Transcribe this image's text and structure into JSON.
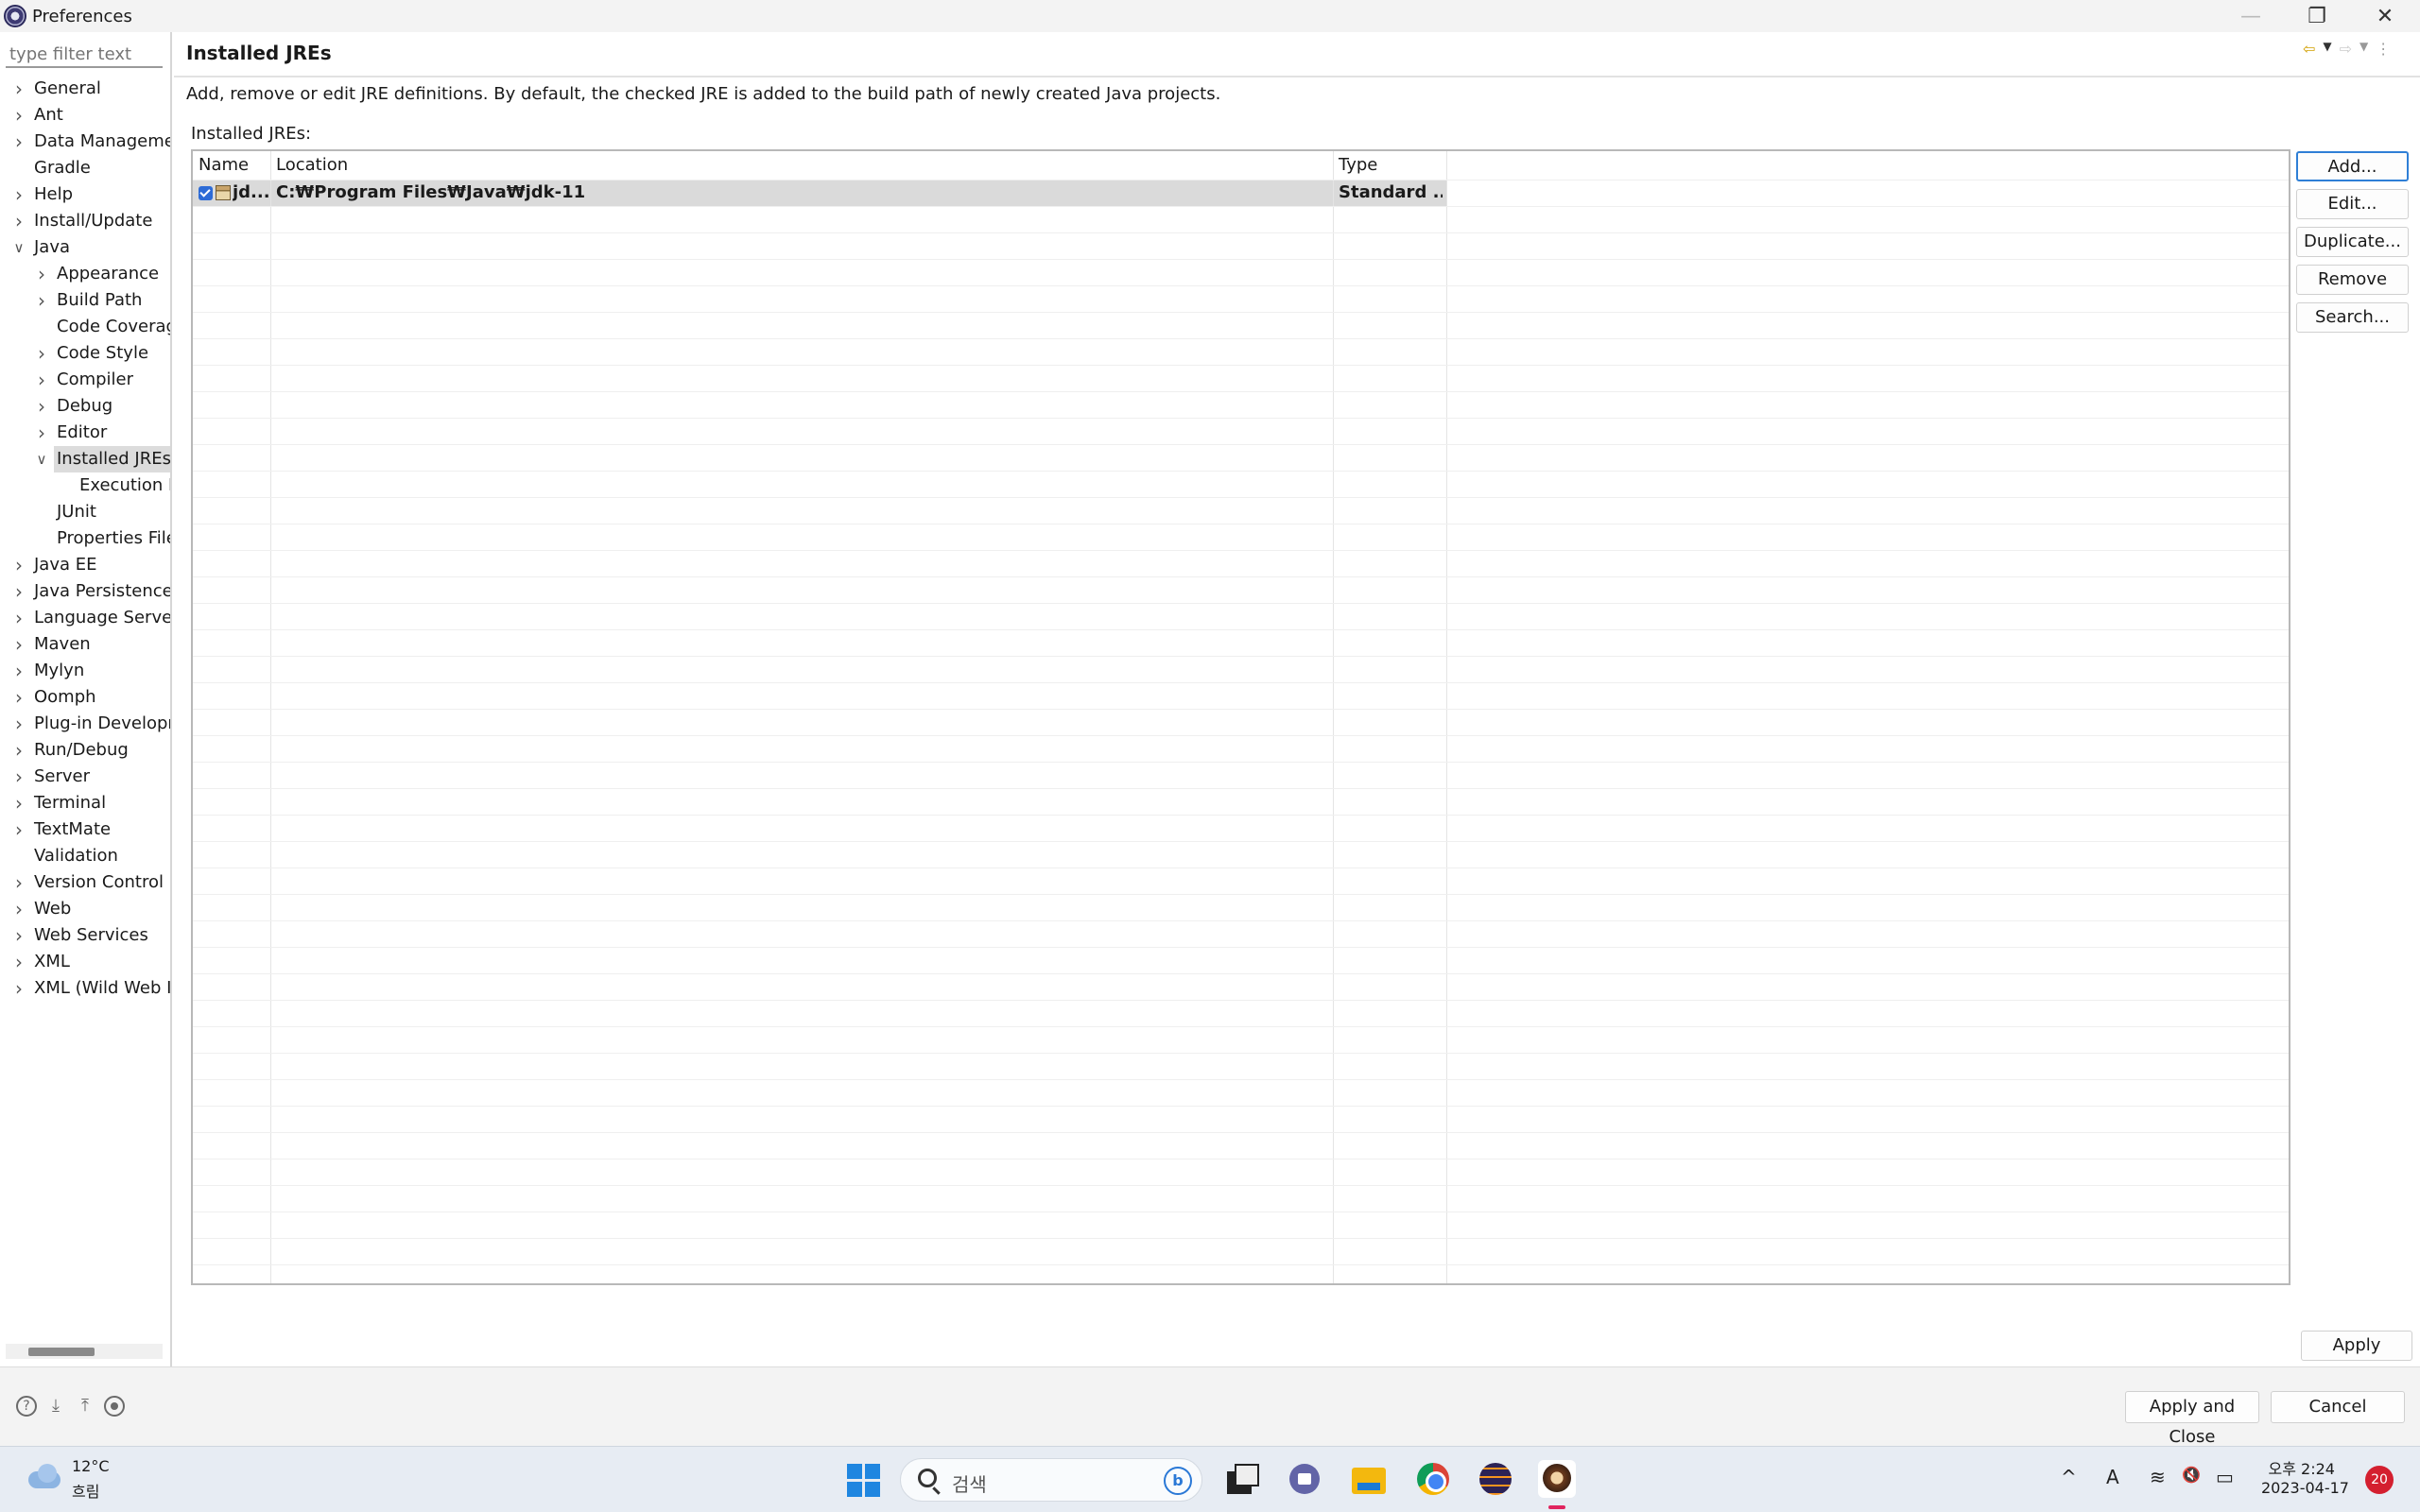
{
  "window": {
    "title": "Preferences",
    "minimize_glyph": "—",
    "restore_glyph": "❐",
    "close_glyph": "✕"
  },
  "filter": {
    "placeholder": "type filter text"
  },
  "tree": [
    {
      "label": "General",
      "depth": 0,
      "expander": ">"
    },
    {
      "label": "Ant",
      "depth": 0,
      "expander": ">"
    },
    {
      "label": "Data Manageme",
      "depth": 0,
      "expander": ">"
    },
    {
      "label": "Gradle",
      "depth": 0,
      "expander": ""
    },
    {
      "label": "Help",
      "depth": 0,
      "expander": ">"
    },
    {
      "label": "Install/Update",
      "depth": 0,
      "expander": ">"
    },
    {
      "label": "Java",
      "depth": 0,
      "expander": "v"
    },
    {
      "label": "Appearance",
      "depth": 1,
      "expander": ">"
    },
    {
      "label": "Build Path",
      "depth": 1,
      "expander": ">"
    },
    {
      "label": "Code Coverag",
      "depth": 1,
      "expander": ""
    },
    {
      "label": "Code Style",
      "depth": 1,
      "expander": ">"
    },
    {
      "label": "Compiler",
      "depth": 1,
      "expander": ">"
    },
    {
      "label": "Debug",
      "depth": 1,
      "expander": ">"
    },
    {
      "label": "Editor",
      "depth": 1,
      "expander": ">"
    },
    {
      "label": "Installed JREs",
      "depth": 1,
      "expander": "v",
      "selected": true
    },
    {
      "label": "Execution E",
      "depth": 2,
      "expander": ""
    },
    {
      "label": "JUnit",
      "depth": 1,
      "expander": ""
    },
    {
      "label": "Properties File",
      "depth": 1,
      "expander": ""
    },
    {
      "label": "Java EE",
      "depth": 0,
      "expander": ">"
    },
    {
      "label": "Java Persistence",
      "depth": 0,
      "expander": ">"
    },
    {
      "label": "Language Server",
      "depth": 0,
      "expander": ">"
    },
    {
      "label": "Maven",
      "depth": 0,
      "expander": ">"
    },
    {
      "label": "Mylyn",
      "depth": 0,
      "expander": ">"
    },
    {
      "label": "Oomph",
      "depth": 0,
      "expander": ">"
    },
    {
      "label": "Plug-in Developr",
      "depth": 0,
      "expander": ">"
    },
    {
      "label": "Run/Debug",
      "depth": 0,
      "expander": ">"
    },
    {
      "label": "Server",
      "depth": 0,
      "expander": ">"
    },
    {
      "label": "Terminal",
      "depth": 0,
      "expander": ">"
    },
    {
      "label": "TextMate",
      "depth": 0,
      "expander": ">"
    },
    {
      "label": "Validation",
      "depth": 0,
      "expander": ""
    },
    {
      "label": "Version Control (",
      "depth": 0,
      "expander": ">"
    },
    {
      "label": "Web",
      "depth": 0,
      "expander": ">"
    },
    {
      "label": "Web Services",
      "depth": 0,
      "expander": ">"
    },
    {
      "label": "XML",
      "depth": 0,
      "expander": ">"
    },
    {
      "label": "XML (Wild Web I",
      "depth": 0,
      "expander": ">"
    }
  ],
  "page": {
    "title": "Installed JREs",
    "description": "Add, remove or edit JRE definitions. By default, the checked JRE is added to the build path of newly created Java projects.",
    "jres_label": "Installed JREs:"
  },
  "table": {
    "columns": [
      "Name",
      "Location",
      "Type"
    ],
    "rows": [
      {
        "name": "jd...",
        "location": "C:₩Program Files₩Java₩jdk-11",
        "type": "Standard ...",
        "checked": true
      }
    ]
  },
  "buttons": {
    "add": "Add...",
    "edit": "Edit...",
    "duplicate": "Duplicate...",
    "remove": "Remove",
    "search": "Search...",
    "apply": "Apply",
    "apply_close": "Apply and Close",
    "cancel": "Cancel"
  },
  "taskbar": {
    "temperature": "12°C",
    "condition": "흐림",
    "search_placeholder": "검색",
    "bing_letter": "b",
    "time": "오후 2:24",
    "date": "2023-04-17",
    "notifications": "20",
    "tray_chevron": "^",
    "ime": "A",
    "wifi_glyph": "≋",
    "mute_glyph": "🔇",
    "battery_glyph": "▭"
  }
}
